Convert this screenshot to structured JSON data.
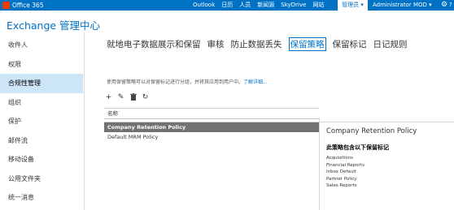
{
  "brand": {
    "name": "Office 365"
  },
  "topnav": {
    "items": [
      "Outlook",
      "日历",
      "人员",
      "新闻源",
      "SkyDrive",
      "网站",
      "管理员"
    ],
    "active": "管理员",
    "admin_label": "管理员 ▾",
    "user": "Administrator MOD ▾",
    "settings_icon": "gear-icon",
    "help_label": "?"
  },
  "app": {
    "title": "Exchange 管理中心"
  },
  "sidebar": {
    "items": [
      {
        "label": "收件人"
      },
      {
        "label": "权限"
      },
      {
        "label": "合规性管理",
        "active": true
      },
      {
        "label": "组织"
      },
      {
        "label": "保护"
      },
      {
        "label": "邮件流"
      },
      {
        "label": "移动设备"
      },
      {
        "label": "公用文件夹"
      },
      {
        "label": "统一消息"
      }
    ]
  },
  "tabs": [
    {
      "label": "就地电子数据展示和保留"
    },
    {
      "label": "审核"
    },
    {
      "label": "防止数据丢失"
    },
    {
      "label": "保留策略",
      "active": true
    },
    {
      "label": "保留标记"
    },
    {
      "label": "日记规则"
    }
  ],
  "description": {
    "text": "使用保留策略可以对保留标记进行分组，并将其应用到用户中。",
    "link": "了解详细..."
  },
  "toolbar": {
    "add": "+",
    "edit": "✎",
    "delete": "🗑",
    "refresh": "↻"
  },
  "table": {
    "column_header": "名称",
    "rows": [
      {
        "name": "Company Retention Policy",
        "selected": true
      },
      {
        "name": "Default MRM Policy",
        "selected": false
      }
    ]
  },
  "details": {
    "title": "Company Retention Policy",
    "subtitle": "此策略包含以下保留标记",
    "tags": [
      "Acquisitions",
      "Financial Reports",
      "Inbox Default",
      "Partner Policy",
      "Sales Reports"
    ]
  },
  "colors": {
    "topbar": "#0072c6",
    "accent": "#0072c6",
    "selected_row": "#717171",
    "active_nav": "#cde6f7",
    "office_logo": "#eb3c00"
  }
}
